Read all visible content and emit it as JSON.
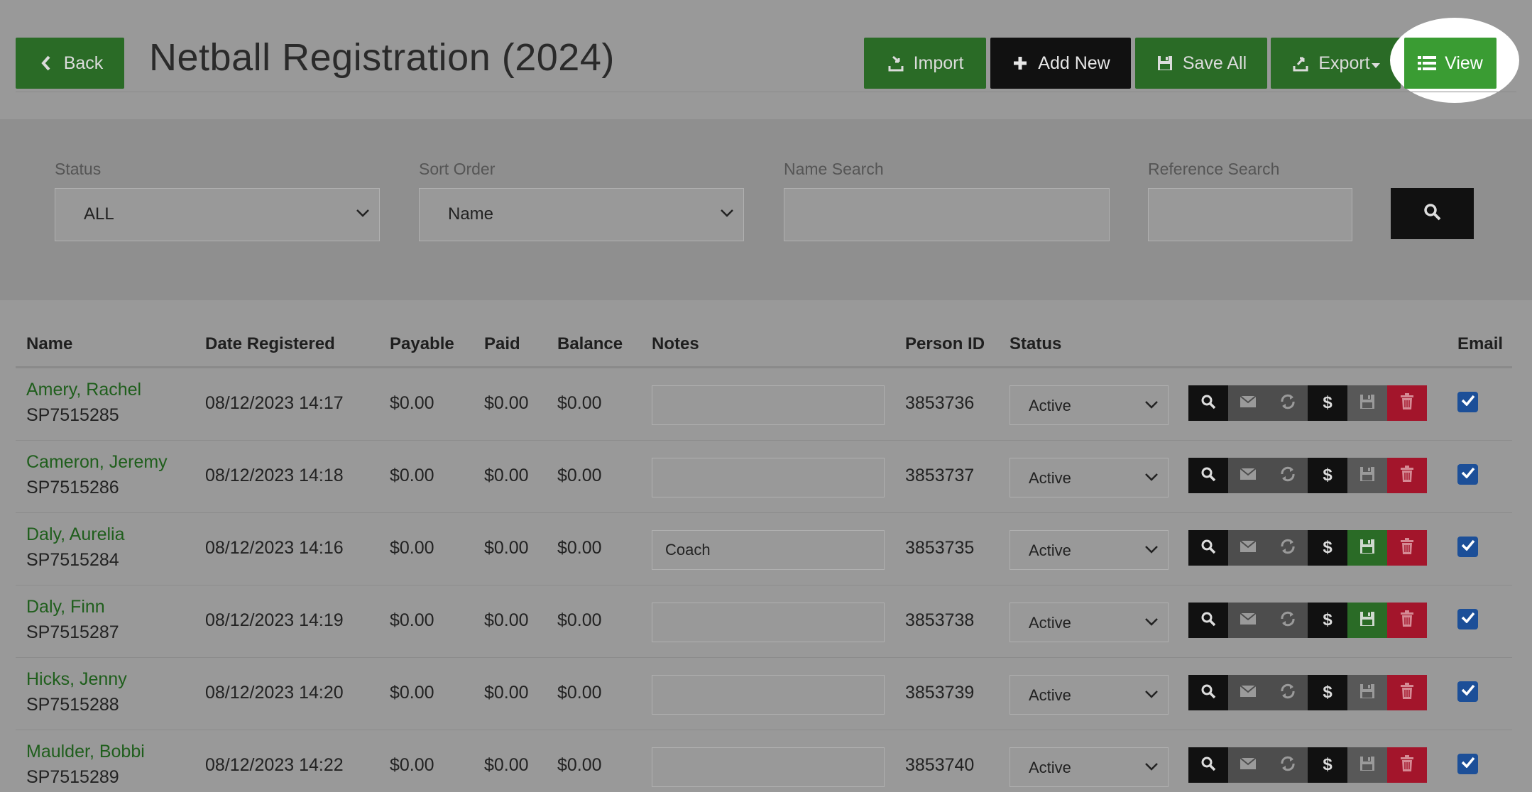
{
  "header": {
    "back_label": "Back",
    "title": "Netball Registration (2024)",
    "import_label": "Import",
    "add_new_label": "Add New",
    "save_all_label": "Save All",
    "export_label": "Export",
    "view_label": "View"
  },
  "filters": {
    "status_label": "Status",
    "status_value": "ALL",
    "sort_label": "Sort Order",
    "sort_value": "Name",
    "name_search_label": "Name Search",
    "name_search_value": "",
    "ref_search_label": "Reference Search",
    "ref_search_value": ""
  },
  "table": {
    "columns": [
      "Name",
      "Date Registered",
      "Payable",
      "Paid",
      "Balance",
      "Notes",
      "Person ID",
      "Status",
      "Email"
    ],
    "rows": [
      {
        "name": "Amery, Rachel",
        "ref": "SP7515285",
        "date": "08/12/2023 14:17",
        "payable": "$0.00",
        "paid": "$0.00",
        "balance": "$0.00",
        "notes": "",
        "person_id": "3853736",
        "status": "Active",
        "save_state": "default",
        "email": true
      },
      {
        "name": "Cameron, Jeremy",
        "ref": "SP7515286",
        "date": "08/12/2023 14:18",
        "payable": "$0.00",
        "paid": "$0.00",
        "balance": "$0.00",
        "notes": "",
        "person_id": "3853737",
        "status": "Active",
        "save_state": "default",
        "email": true
      },
      {
        "name": "Daly, Aurelia",
        "ref": "SP7515284",
        "date": "08/12/2023 14:16",
        "payable": "$0.00",
        "paid": "$0.00",
        "balance": "$0.00",
        "notes": "Coach",
        "person_id": "3853735",
        "status": "Active",
        "save_state": "active",
        "email": true
      },
      {
        "name": "Daly, Finn",
        "ref": "SP7515287",
        "date": "08/12/2023 14:19",
        "payable": "$0.00",
        "paid": "$0.00",
        "balance": "$0.00",
        "notes": "",
        "person_id": "3853738",
        "status": "Active",
        "save_state": "active",
        "email": true
      },
      {
        "name": "Hicks, Jenny",
        "ref": "SP7515288",
        "date": "08/12/2023 14:20",
        "payable": "$0.00",
        "paid": "$0.00",
        "balance": "$0.00",
        "notes": "",
        "person_id": "3853739",
        "status": "Active",
        "save_state": "default",
        "email": true
      },
      {
        "name": "Maulder, Bobbi",
        "ref": "SP7515289",
        "date": "08/12/2023 14:22",
        "payable": "$0.00",
        "paid": "$0.00",
        "balance": "$0.00",
        "notes": "",
        "person_id": "3853740",
        "status": "Active",
        "save_state": "default",
        "email": true
      }
    ]
  },
  "icons": {
    "back": "chevron-left-icon",
    "import": "import-icon",
    "add_new": "plus-icon",
    "save_all": "floppy-icon",
    "export": "export-icon",
    "view": "list-icon",
    "search": "search-icon",
    "row_actions": [
      "search-icon",
      "envelope-icon",
      "refresh-icon",
      "dollar-icon",
      "floppy-icon",
      "trash-icon"
    ]
  },
  "colors": {
    "primary_green": "#2a6b26",
    "view_green": "#3a9c33",
    "danger_red": "#a3152b",
    "checkbox_blue": "#1c4f98"
  }
}
